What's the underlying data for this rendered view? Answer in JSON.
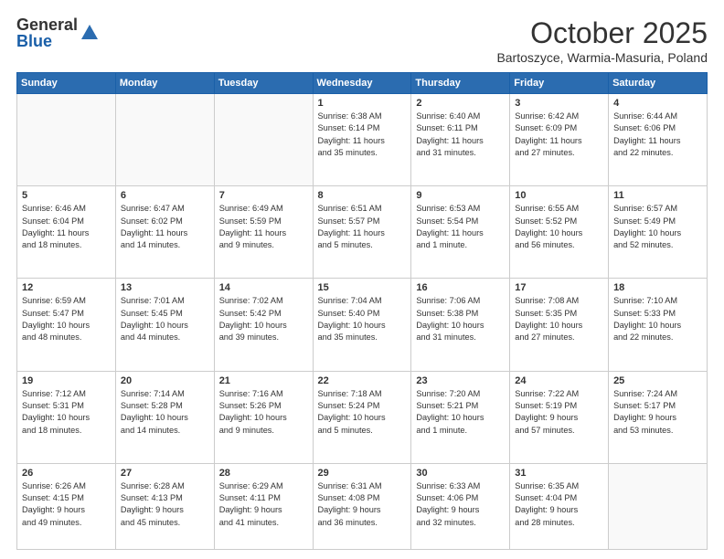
{
  "logo": {
    "general": "General",
    "blue": "Blue"
  },
  "title": {
    "month": "October 2025",
    "location": "Bartoszyce, Warmia-Masuria, Poland"
  },
  "weekdays": [
    "Sunday",
    "Monday",
    "Tuesday",
    "Wednesday",
    "Thursday",
    "Friday",
    "Saturday"
  ],
  "weeks": [
    [
      {
        "day": "",
        "info": ""
      },
      {
        "day": "",
        "info": ""
      },
      {
        "day": "",
        "info": ""
      },
      {
        "day": "1",
        "info": "Sunrise: 6:38 AM\nSunset: 6:14 PM\nDaylight: 11 hours\nand 35 minutes."
      },
      {
        "day": "2",
        "info": "Sunrise: 6:40 AM\nSunset: 6:11 PM\nDaylight: 11 hours\nand 31 minutes."
      },
      {
        "day": "3",
        "info": "Sunrise: 6:42 AM\nSunset: 6:09 PM\nDaylight: 11 hours\nand 27 minutes."
      },
      {
        "day": "4",
        "info": "Sunrise: 6:44 AM\nSunset: 6:06 PM\nDaylight: 11 hours\nand 22 minutes."
      }
    ],
    [
      {
        "day": "5",
        "info": "Sunrise: 6:46 AM\nSunset: 6:04 PM\nDaylight: 11 hours\nand 18 minutes."
      },
      {
        "day": "6",
        "info": "Sunrise: 6:47 AM\nSunset: 6:02 PM\nDaylight: 11 hours\nand 14 minutes."
      },
      {
        "day": "7",
        "info": "Sunrise: 6:49 AM\nSunset: 5:59 PM\nDaylight: 11 hours\nand 9 minutes."
      },
      {
        "day": "8",
        "info": "Sunrise: 6:51 AM\nSunset: 5:57 PM\nDaylight: 11 hours\nand 5 minutes."
      },
      {
        "day": "9",
        "info": "Sunrise: 6:53 AM\nSunset: 5:54 PM\nDaylight: 11 hours\nand 1 minute."
      },
      {
        "day": "10",
        "info": "Sunrise: 6:55 AM\nSunset: 5:52 PM\nDaylight: 10 hours\nand 56 minutes."
      },
      {
        "day": "11",
        "info": "Sunrise: 6:57 AM\nSunset: 5:49 PM\nDaylight: 10 hours\nand 52 minutes."
      }
    ],
    [
      {
        "day": "12",
        "info": "Sunrise: 6:59 AM\nSunset: 5:47 PM\nDaylight: 10 hours\nand 48 minutes."
      },
      {
        "day": "13",
        "info": "Sunrise: 7:01 AM\nSunset: 5:45 PM\nDaylight: 10 hours\nand 44 minutes."
      },
      {
        "day": "14",
        "info": "Sunrise: 7:02 AM\nSunset: 5:42 PM\nDaylight: 10 hours\nand 39 minutes."
      },
      {
        "day": "15",
        "info": "Sunrise: 7:04 AM\nSunset: 5:40 PM\nDaylight: 10 hours\nand 35 minutes."
      },
      {
        "day": "16",
        "info": "Sunrise: 7:06 AM\nSunset: 5:38 PM\nDaylight: 10 hours\nand 31 minutes."
      },
      {
        "day": "17",
        "info": "Sunrise: 7:08 AM\nSunset: 5:35 PM\nDaylight: 10 hours\nand 27 minutes."
      },
      {
        "day": "18",
        "info": "Sunrise: 7:10 AM\nSunset: 5:33 PM\nDaylight: 10 hours\nand 22 minutes."
      }
    ],
    [
      {
        "day": "19",
        "info": "Sunrise: 7:12 AM\nSunset: 5:31 PM\nDaylight: 10 hours\nand 18 minutes."
      },
      {
        "day": "20",
        "info": "Sunrise: 7:14 AM\nSunset: 5:28 PM\nDaylight: 10 hours\nand 14 minutes."
      },
      {
        "day": "21",
        "info": "Sunrise: 7:16 AM\nSunset: 5:26 PM\nDaylight: 10 hours\nand 9 minutes."
      },
      {
        "day": "22",
        "info": "Sunrise: 7:18 AM\nSunset: 5:24 PM\nDaylight: 10 hours\nand 5 minutes."
      },
      {
        "day": "23",
        "info": "Sunrise: 7:20 AM\nSunset: 5:21 PM\nDaylight: 10 hours\nand 1 minute."
      },
      {
        "day": "24",
        "info": "Sunrise: 7:22 AM\nSunset: 5:19 PM\nDaylight: 9 hours\nand 57 minutes."
      },
      {
        "day": "25",
        "info": "Sunrise: 7:24 AM\nSunset: 5:17 PM\nDaylight: 9 hours\nand 53 minutes."
      }
    ],
    [
      {
        "day": "26",
        "info": "Sunrise: 6:26 AM\nSunset: 4:15 PM\nDaylight: 9 hours\nand 49 minutes."
      },
      {
        "day": "27",
        "info": "Sunrise: 6:28 AM\nSunset: 4:13 PM\nDaylight: 9 hours\nand 45 minutes."
      },
      {
        "day": "28",
        "info": "Sunrise: 6:29 AM\nSunset: 4:11 PM\nDaylight: 9 hours\nand 41 minutes."
      },
      {
        "day": "29",
        "info": "Sunrise: 6:31 AM\nSunset: 4:08 PM\nDaylight: 9 hours\nand 36 minutes."
      },
      {
        "day": "30",
        "info": "Sunrise: 6:33 AM\nSunset: 4:06 PM\nDaylight: 9 hours\nand 32 minutes."
      },
      {
        "day": "31",
        "info": "Sunrise: 6:35 AM\nSunset: 4:04 PM\nDaylight: 9 hours\nand 28 minutes."
      },
      {
        "day": "",
        "info": ""
      }
    ]
  ]
}
